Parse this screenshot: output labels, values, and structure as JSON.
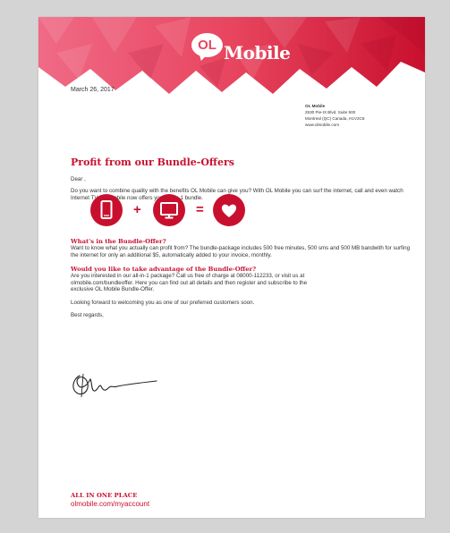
{
  "brand": {
    "logo_badge": "OL",
    "name": "Mobile",
    "accent_color": "#c8102e",
    "banner_colors": [
      "#f06a86",
      "#e8455f",
      "#c8102e"
    ]
  },
  "letter": {
    "date": "March 26, 2017",
    "sender": {
      "company": "OL Mobile",
      "address_line1": "2530 Pie-IX Blvd, Suite 500",
      "address_line2": "Montreal (QC) Canada, H1V2C8",
      "website": "www.olmobile.com"
    },
    "title": "Profit from our Bundle-Offers",
    "salutation": "Dear ,",
    "intro": "Do you want to combine quality with the benefits OL Mobile can give you? With OL Mobile you can surf the internet, call and even watch Internet TV. OL Mobile now offers you a 3-in-1 bundle.",
    "bundle_icons": [
      "phone-icon",
      "monitor-icon",
      "heart-icon"
    ],
    "operators": {
      "plus": "+",
      "equals": "="
    },
    "section1": {
      "heading": "What's in the Bundle-Offer?",
      "body": "Want to know what you actually can profit from? The bundle-package includes 500 free minutes, 500 sms and 500 MB bandwith for surfing the internet for only an additional $5, automatically added to your invoice, monthly."
    },
    "section2": {
      "heading": "Would you like to take advantage of the Bundle-Offer?",
      "body": "Are you interested in our all-in-1 package? Call us free of charge at 08000-112233, or visit us at olmobile.com/bundleoffer. Here you can find out all details and then register and subscribe to the exclusive OL Mobile Bundle-Offer."
    },
    "closing_line": "Looking forward to welcoming you as one of our preferred customers soon.",
    "regards": "Best regards,"
  },
  "footer": {
    "heading": "ALL IN ONE PLACE",
    "url": "olmobile.com/myaccount"
  }
}
